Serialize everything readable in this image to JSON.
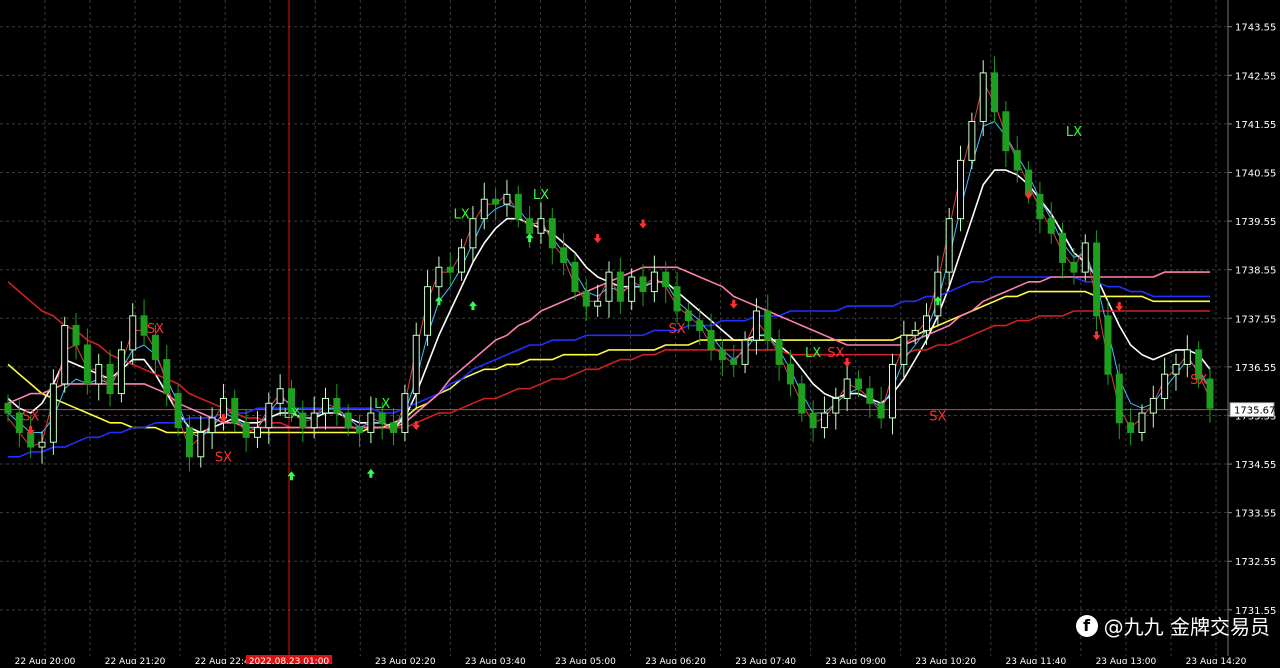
{
  "chart_data": {
    "type": "candlestick",
    "y_axis": {
      "ticks": [
        1743.55,
        1742.55,
        1741.55,
        1740.55,
        1739.55,
        1738.55,
        1737.55,
        1736.55,
        1735.55,
        1734.55,
        1733.55,
        1732.55,
        1731.55
      ],
      "range": [
        1730.6,
        1744.1
      ]
    },
    "x_axis": {
      "ticks": [
        "22 Aug 20:00",
        "22 Aug 21:20",
        "22 Aug 22:40",
        "2022.08.23 01:00",
        "23 Aug 02:20",
        "23 Aug 03:40",
        "23 Aug 05:00",
        "23 Aug 06:20",
        "23 Aug 07:40",
        "23 Aug 09:00",
        "23 Aug 10:20",
        "23 Aug 11:40",
        "23 Aug 13:00",
        "23 Aug 14:20"
      ]
    },
    "current_price": 1735.67,
    "price_series": [
      1735.6,
      1735.2,
      1734.9,
      1735.0,
      1736.2,
      1737.4,
      1737.0,
      1736.2,
      1736.6,
      1736.0,
      1736.9,
      1737.6,
      1737.2,
      1736.7,
      1736.0,
      1735.3,
      1734.7,
      1735.2,
      1735.5,
      1735.9,
      1735.4,
      1735.1,
      1735.3,
      1735.8,
      1736.1,
      1735.6,
      1735.3,
      1735.6,
      1735.9,
      1735.6,
      1735.3,
      1735.2,
      1735.6,
      1735.4,
      1735.2,
      1736.0,
      1737.2,
      1738.2,
      1738.6,
      1738.5,
      1739.0,
      1739.6,
      1740.0,
      1739.9,
      1740.1,
      1739.6,
      1739.3,
      1739.6,
      1739.0,
      1738.7,
      1738.1,
      1737.8,
      1737.9,
      1738.5,
      1737.9,
      1738.4,
      1738.1,
      1738.5,
      1738.2,
      1737.7,
      1737.5,
      1737.3,
      1736.9,
      1736.7,
      1736.6,
      1737.1,
      1737.7,
      1737.1,
      1736.6,
      1736.2,
      1735.6,
      1735.3,
      1735.6,
      1735.9,
      1736.3,
      1736.1,
      1735.8,
      1735.5,
      1736.6,
      1737.2,
      1737.3,
      1737.6,
      1738.5,
      1739.6,
      1740.8,
      1741.6,
      1742.6,
      1741.8,
      1741.0,
      1740.6,
      1740.1,
      1739.6,
      1739.3,
      1738.7,
      1738.5,
      1739.1,
      1737.6,
      1736.4,
      1735.4,
      1735.2,
      1735.6,
      1735.9,
      1736.4,
      1736.6,
      1736.9,
      1736.3,
      1735.7
    ],
    "moving_averages": [
      {
        "color": "#ffffff",
        "values": [
          1735.9,
          1735.7,
          1735.6,
          1735.8,
          1736.2,
          1736.7,
          1736.6,
          1736.5,
          1736.4,
          1736.3,
          1736.5,
          1736.7,
          1736.7,
          1736.4,
          1736.0,
          1735.6,
          1735.3,
          1735.2,
          1735.3,
          1735.4,
          1735.5,
          1735.4,
          1735.4,
          1735.5,
          1735.6,
          1735.6,
          1735.5,
          1735.5,
          1735.6,
          1735.6,
          1735.5,
          1735.4,
          1735.4,
          1735.4,
          1735.3,
          1735.5,
          1736.0,
          1736.6,
          1737.2,
          1737.7,
          1738.2,
          1738.7,
          1739.1,
          1739.4,
          1739.6,
          1739.6,
          1739.5,
          1739.4,
          1739.3,
          1739.1,
          1738.9,
          1738.6,
          1738.4,
          1738.3,
          1738.2,
          1738.2,
          1738.2,
          1738.3,
          1738.3,
          1738.1,
          1737.9,
          1737.7,
          1737.5,
          1737.3,
          1737.1,
          1737.1,
          1737.2,
          1737.2,
          1737.0,
          1736.8,
          1736.5,
          1736.2,
          1736.0,
          1735.9,
          1736.0,
          1736.0,
          1735.9,
          1735.8,
          1736.0,
          1736.3,
          1736.7,
          1737.1,
          1737.6,
          1738.2,
          1738.9,
          1739.6,
          1740.3,
          1740.6,
          1740.6,
          1740.5,
          1740.3,
          1740.0,
          1739.7,
          1739.3,
          1738.9,
          1738.7,
          1738.4,
          1737.9,
          1737.4,
          1737.0,
          1736.8,
          1736.7,
          1736.8,
          1736.9,
          1736.9,
          1736.8,
          1736.5
        ]
      },
      {
        "color": "#d02020",
        "values": [
          1738.3,
          1738.1,
          1737.9,
          1737.7,
          1737.6,
          1737.4,
          1737.3,
          1737.1,
          1737.0,
          1736.8,
          1736.7,
          1736.6,
          1736.5,
          1736.4,
          1736.3,
          1736.2,
          1736.0,
          1735.9,
          1735.8,
          1735.7,
          1735.6,
          1735.5,
          1735.5,
          1735.4,
          1735.4,
          1735.3,
          1735.3,
          1735.3,
          1735.3,
          1735.3,
          1735.3,
          1735.3,
          1735.3,
          1735.3,
          1735.3,
          1735.3,
          1735.4,
          1735.5,
          1735.6,
          1735.6,
          1735.7,
          1735.8,
          1735.9,
          1735.9,
          1736.0,
          1736.1,
          1736.1,
          1736.2,
          1736.3,
          1736.3,
          1736.4,
          1736.5,
          1736.5,
          1736.6,
          1736.7,
          1736.7,
          1736.8,
          1736.8,
          1736.9,
          1736.9,
          1736.9,
          1736.9,
          1736.9,
          1736.9,
          1736.9,
          1736.9,
          1736.9,
          1736.9,
          1736.9,
          1736.8,
          1736.8,
          1736.8,
          1736.8,
          1736.8,
          1736.8,
          1736.8,
          1736.8,
          1736.8,
          1736.8,
          1736.8,
          1736.9,
          1736.9,
          1737.0,
          1737.0,
          1737.1,
          1737.2,
          1737.3,
          1737.4,
          1737.4,
          1737.5,
          1737.5,
          1737.6,
          1737.6,
          1737.6,
          1737.7,
          1737.7,
          1737.7,
          1737.7,
          1737.7,
          1737.7,
          1737.7,
          1737.7,
          1737.7,
          1737.7,
          1737.7,
          1737.7,
          1737.7
        ]
      },
      {
        "color": "#ffff40",
        "values": [
          1736.6,
          1736.4,
          1736.2,
          1736.0,
          1735.9,
          1735.8,
          1735.7,
          1735.6,
          1735.5,
          1735.4,
          1735.4,
          1735.3,
          1735.3,
          1735.3,
          1735.2,
          1735.2,
          1735.2,
          1735.2,
          1735.2,
          1735.2,
          1735.2,
          1735.2,
          1735.2,
          1735.2,
          1735.2,
          1735.2,
          1735.2,
          1735.2,
          1735.2,
          1735.2,
          1735.2,
          1735.2,
          1735.3,
          1735.3,
          1735.4,
          1735.5,
          1735.7,
          1735.8,
          1736.0,
          1736.1,
          1736.3,
          1736.4,
          1736.5,
          1736.5,
          1736.6,
          1736.6,
          1736.7,
          1736.7,
          1736.7,
          1736.8,
          1736.8,
          1736.8,
          1736.8,
          1736.9,
          1736.9,
          1736.9,
          1736.9,
          1736.9,
          1737.0,
          1737.0,
          1737.0,
          1737.1,
          1737.1,
          1737.1,
          1737.1,
          1737.1,
          1737.1,
          1737.1,
          1737.1,
          1737.1,
          1737.1,
          1737.1,
          1737.1,
          1737.1,
          1737.1,
          1737.1,
          1737.1,
          1737.1,
          1737.1,
          1737.2,
          1737.2,
          1737.3,
          1737.4,
          1737.5,
          1737.6,
          1737.7,
          1737.8,
          1737.9,
          1738.0,
          1738.0,
          1738.1,
          1738.1,
          1738.1,
          1738.1,
          1738.1,
          1738.1,
          1738.0,
          1738.0,
          1738.0,
          1738.0,
          1738.0,
          1737.9,
          1737.9,
          1737.9,
          1737.9,
          1737.9,
          1737.9
        ]
      },
      {
        "color": "#2030ff",
        "values": [
          1734.7,
          1734.7,
          1734.8,
          1734.8,
          1734.9,
          1734.9,
          1735.0,
          1735.1,
          1735.1,
          1735.2,
          1735.2,
          1735.3,
          1735.3,
          1735.4,
          1735.4,
          1735.4,
          1735.5,
          1735.5,
          1735.5,
          1735.6,
          1735.6,
          1735.6,
          1735.7,
          1735.7,
          1735.7,
          1735.7,
          1735.7,
          1735.7,
          1735.7,
          1735.7,
          1735.7,
          1735.7,
          1735.7,
          1735.6,
          1735.6,
          1735.7,
          1735.8,
          1735.9,
          1736.0,
          1736.2,
          1736.3,
          1736.5,
          1736.6,
          1736.7,
          1736.8,
          1736.9,
          1737.0,
          1737.0,
          1737.1,
          1737.1,
          1737.1,
          1737.2,
          1737.2,
          1737.2,
          1737.2,
          1737.2,
          1737.2,
          1737.3,
          1737.3,
          1737.3,
          1737.4,
          1737.4,
          1737.4,
          1737.5,
          1737.5,
          1737.5,
          1737.6,
          1737.6,
          1737.6,
          1737.7,
          1737.7,
          1737.7,
          1737.7,
          1737.7,
          1737.8,
          1737.8,
          1737.8,
          1737.8,
          1737.8,
          1737.9,
          1737.9,
          1738.0,
          1738.0,
          1738.1,
          1738.2,
          1738.3,
          1738.3,
          1738.4,
          1738.4,
          1738.4,
          1738.4,
          1738.4,
          1738.4,
          1738.4,
          1738.4,
          1738.3,
          1738.3,
          1738.2,
          1738.2,
          1738.1,
          1738.1,
          1738.0,
          1738.0,
          1738.0,
          1738.0,
          1738.0,
          1738.0
        ]
      },
      {
        "color": "#ff80b0",
        "values": [
          1735.8,
          1735.9,
          1736.0,
          1736.0,
          1736.1,
          1736.2,
          1736.2,
          1736.2,
          1736.2,
          1736.2,
          1736.2,
          1736.2,
          1736.2,
          1736.1,
          1736.0,
          1735.8,
          1735.7,
          1735.6,
          1735.5,
          1735.4,
          1735.4,
          1735.3,
          1735.3,
          1735.3,
          1735.3,
          1735.3,
          1735.3,
          1735.3,
          1735.3,
          1735.3,
          1735.3,
          1735.3,
          1735.3,
          1735.3,
          1735.3,
          1735.4,
          1735.6,
          1735.8,
          1736.0,
          1736.3,
          1736.5,
          1736.7,
          1736.9,
          1737.1,
          1737.2,
          1737.4,
          1737.5,
          1737.7,
          1737.8,
          1737.9,
          1738.0,
          1738.1,
          1738.2,
          1738.3,
          1738.4,
          1738.5,
          1738.6,
          1738.6,
          1738.6,
          1738.6,
          1738.5,
          1738.4,
          1738.3,
          1738.2,
          1738.0,
          1737.9,
          1737.8,
          1737.7,
          1737.6,
          1737.5,
          1737.4,
          1737.3,
          1737.2,
          1737.1,
          1737.0,
          1737.0,
          1737.0,
          1737.0,
          1737.0,
          1737.0,
          1737.1,
          1737.2,
          1737.3,
          1737.4,
          1737.6,
          1737.7,
          1737.9,
          1738.0,
          1738.1,
          1738.2,
          1738.3,
          1738.3,
          1738.4,
          1738.4,
          1738.4,
          1738.4,
          1738.4,
          1738.4,
          1738.4,
          1738.4,
          1738.4,
          1738.4,
          1738.5,
          1738.5,
          1738.5,
          1738.5,
          1738.5
        ]
      },
      {
        "color": "#40c0ff",
        "values": [
          1735.6,
          1735.4,
          1735.2,
          1735.2,
          1735.5,
          1736.1,
          1736.3,
          1736.2,
          1736.3,
          1736.2,
          1736.5,
          1736.9,
          1737.0,
          1736.8,
          1736.3,
          1735.8,
          1735.2,
          1735.1,
          1735.3,
          1735.6,
          1735.5,
          1735.3,
          1735.3,
          1735.6,
          1735.9,
          1735.8,
          1735.5,
          1735.5,
          1735.7,
          1735.7,
          1735.5,
          1735.3,
          1735.4,
          1735.4,
          1735.3,
          1735.6,
          1736.3,
          1737.2,
          1737.9,
          1738.2,
          1738.6,
          1739.1,
          1739.6,
          1739.8,
          1739.9,
          1739.8,
          1739.5,
          1739.5,
          1739.2,
          1738.9,
          1738.5,
          1738.1,
          1738.0,
          1738.2,
          1738.1,
          1738.2,
          1738.2,
          1738.3,
          1738.3,
          1737.9,
          1737.7,
          1737.5,
          1737.2,
          1736.9,
          1736.7,
          1736.9,
          1737.2,
          1737.2,
          1736.9,
          1736.5,
          1736.0,
          1735.6,
          1735.6,
          1735.8,
          1736.0,
          1736.1,
          1735.9,
          1735.7,
          1736.1,
          1736.7,
          1737.0,
          1737.3,
          1737.9,
          1738.8,
          1739.8,
          1740.7,
          1741.5,
          1741.6,
          1741.3,
          1740.9,
          1740.5,
          1740.0,
          1739.6,
          1739.1,
          1738.8,
          1738.9,
          1738.3,
          1737.3,
          1736.3,
          1735.8,
          1735.7,
          1735.8,
          1736.1,
          1736.4,
          1736.7,
          1736.5,
          1736.1
        ]
      },
      {
        "color": "#e04040",
        "values": [
          1735.5,
          1735.2,
          1734.9,
          1735.0,
          1735.9,
          1736.9,
          1737.0,
          1736.5,
          1736.5,
          1736.1,
          1736.6,
          1737.3,
          1737.3,
          1736.9,
          1736.2,
          1735.5,
          1734.9,
          1735.1,
          1735.4,
          1735.8,
          1735.5,
          1735.2,
          1735.3,
          1735.7,
          1736.0,
          1735.7,
          1735.4,
          1735.5,
          1735.8,
          1735.7,
          1735.4,
          1735.2,
          1735.5,
          1735.4,
          1735.2,
          1735.8,
          1736.9,
          1737.9,
          1738.5,
          1738.5,
          1738.9,
          1739.5,
          1739.9,
          1739.9,
          1740.1,
          1739.7,
          1739.4,
          1739.6,
          1739.1,
          1738.8,
          1738.2,
          1737.9,
          1737.9,
          1738.4,
          1738.0,
          1738.3,
          1738.2,
          1738.4,
          1738.2,
          1737.8,
          1737.6,
          1737.4,
          1737.0,
          1736.8,
          1736.6,
          1737.0,
          1737.5,
          1737.2,
          1736.8,
          1736.3,
          1735.8,
          1735.4,
          1735.5,
          1735.8,
          1736.2,
          1736.1,
          1735.9,
          1735.6,
          1736.4,
          1737.0,
          1737.2,
          1737.5,
          1738.3,
          1739.4,
          1740.5,
          1741.4,
          1742.4,
          1742.0,
          1741.3,
          1740.8,
          1740.3,
          1739.8,
          1739.4,
          1738.9,
          1738.6,
          1739.0,
          1737.9,
          1736.7,
          1735.7,
          1735.3,
          1735.5,
          1735.8,
          1736.3,
          1736.5,
          1736.8,
          1736.4,
          1735.9
        ]
      }
    ],
    "markers": [
      {
        "text": "SX",
        "i": 2,
        "price": 1735.45,
        "color": "#ff3030"
      },
      {
        "text": "SX",
        "i": 13,
        "price": 1737.25,
        "color": "#ff3030"
      },
      {
        "text": "SX",
        "i": 19,
        "price": 1734.6,
        "color": "#ff3030"
      },
      {
        "text": "LX",
        "i": 25,
        "price": 1735.5,
        "color": "#30ff30"
      },
      {
        "text": "LX",
        "i": 33,
        "price": 1735.7,
        "color": "#30ff30"
      },
      {
        "text": "LX",
        "i": 40,
        "price": 1739.6,
        "color": "#30ff30"
      },
      {
        "text": "LX",
        "i": 47,
        "price": 1740.0,
        "color": "#30ff30"
      },
      {
        "text": "SX",
        "i": 59,
        "price": 1737.25,
        "color": "#ff3030"
      },
      {
        "text": "LX",
        "i": 71,
        "price": 1736.75,
        "color": "#30ff30"
      },
      {
        "text": "SX",
        "i": 73,
        "price": 1736.75,
        "color": "#ff3030"
      },
      {
        "text": "SX",
        "i": 82,
        "price": 1735.45,
        "color": "#ff3030"
      },
      {
        "text": "LX",
        "i": 94,
        "price": 1741.3,
        "color": "#30ff30"
      },
      {
        "text": "SX",
        "i": 105,
        "price": 1736.2,
        "color": "#ff3030"
      }
    ],
    "buy_arrows": [
      {
        "i": 25,
        "price": 1734.3
      },
      {
        "i": 32,
        "price": 1734.35
      },
      {
        "i": 38,
        "price": 1737.9
      },
      {
        "i": 41,
        "price": 1737.8
      },
      {
        "i": 46,
        "price": 1739.2
      },
      {
        "i": 82,
        "price": 1737.9
      }
    ],
    "sell_arrows": [
      {
        "i": 2,
        "price": 1735.25
      },
      {
        "i": 19,
        "price": 1735.5
      },
      {
        "i": 36,
        "price": 1735.35
      },
      {
        "i": 52,
        "price": 1739.2
      },
      {
        "i": 56,
        "price": 1739.5
      },
      {
        "i": 64,
        "price": 1737.85
      },
      {
        "i": 74,
        "price": 1736.65
      },
      {
        "i": 90,
        "price": 1740.1
      },
      {
        "i": 96,
        "price": 1737.2
      },
      {
        "i": 98,
        "price": 1737.8
      }
    ]
  },
  "watermark": {
    "icon_letter": "f",
    "text": "@九九 金牌交易员"
  },
  "colors": {
    "background": "#000000",
    "grid": "#3c3c3c",
    "bull": "#c8ffc8",
    "bear": "#1f9f1f",
    "axis_text": "#ffffff",
    "time_highlight": "#e01010",
    "current_price_line": "#d04040",
    "current_price_box_bg": "#ffffff",
    "current_price_box_text": "#000000"
  }
}
